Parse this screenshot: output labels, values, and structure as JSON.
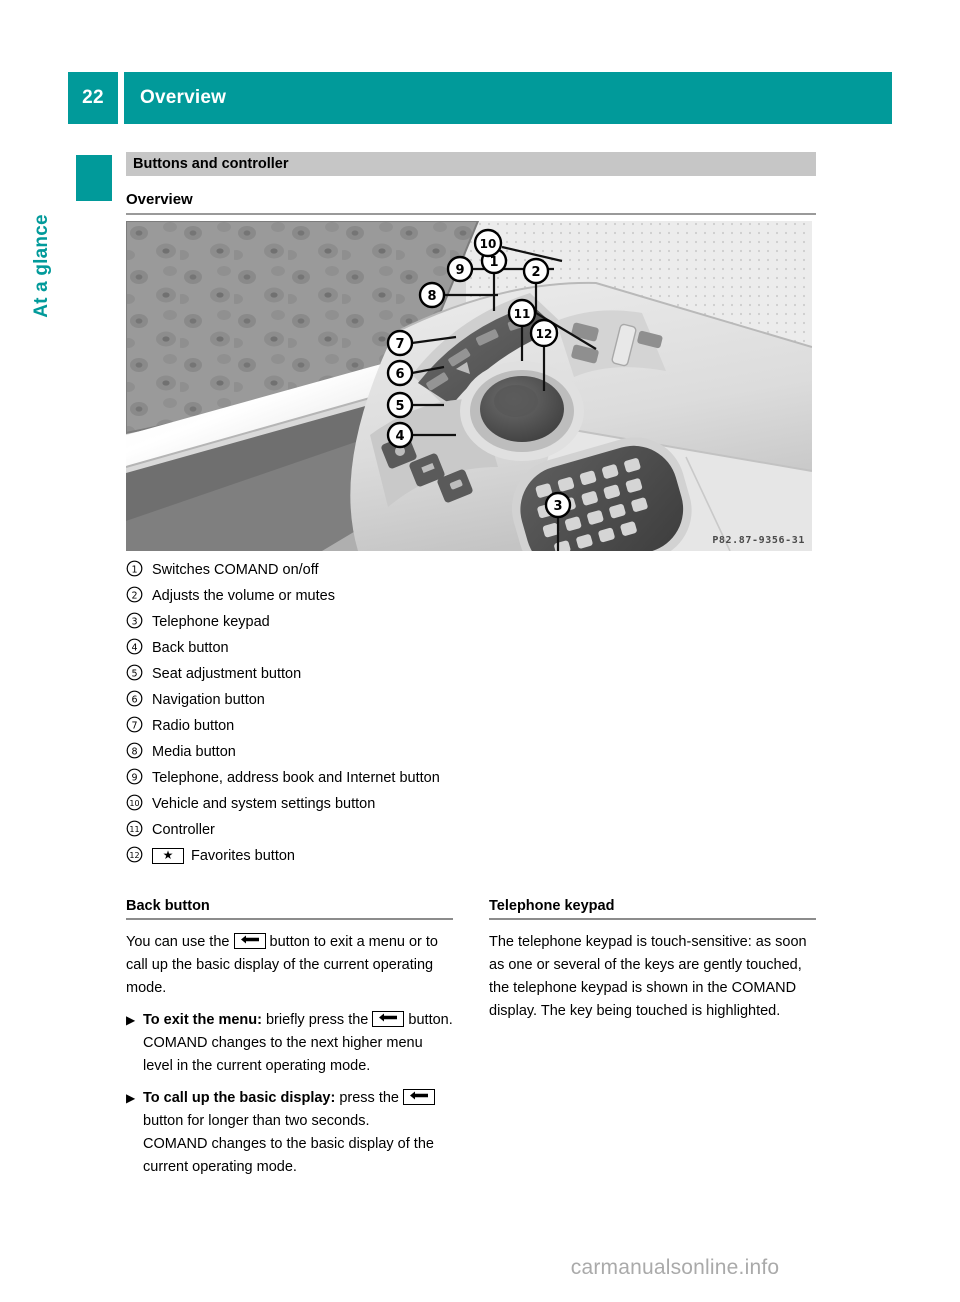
{
  "header": {
    "page_number": "22",
    "title": "Overview"
  },
  "side_tab": {
    "label": "At a glance"
  },
  "section": {
    "bar_title": "Buttons and controller",
    "sub_heading": "Overview"
  },
  "figure": {
    "image_code": "P82.87-9356-31",
    "alt": "COMAND center console with buttons, controller and telephone keypad",
    "callouts": [
      "1",
      "2",
      "3",
      "4",
      "5",
      "6",
      "7",
      "8",
      "9",
      "10",
      "11",
      "12"
    ]
  },
  "legend": {
    "items": [
      {
        "marker": "1",
        "label": "Switches COMAND on/off"
      },
      {
        "marker": "2",
        "label": "Adjusts the volume or mutes"
      },
      {
        "marker": "3",
        "label": "Telephone keypad"
      },
      {
        "marker": "4",
        "label": "Back button"
      },
      {
        "marker": "5",
        "label": "Seat adjustment button"
      },
      {
        "marker": "6",
        "label": "Navigation button"
      },
      {
        "marker": "7",
        "label": "Radio button"
      },
      {
        "marker": "8",
        "label": "Media button"
      },
      {
        "marker": "9",
        "label": "Telephone, address book and Internet button"
      },
      {
        "marker": "10",
        "label": "Vehicle and system settings button"
      },
      {
        "marker": "11",
        "label": "Controller"
      },
      {
        "marker": "12",
        "label": "Favorites button",
        "key_icon": "star-key-icon"
      }
    ]
  },
  "columns": {
    "left": {
      "heading": "Back button",
      "intro_before_key": "You can use the",
      "intro_after_key": "button to exit a menu or to call up the basic display of the current operating mode.",
      "steps": [
        {
          "bullet": "▶",
          "bold": "To exit the menu:",
          "text_before_key": " briefly press the",
          "text_after_key": "button.",
          "follow_up": "COMAND changes to the next higher menu level in the current operating mode."
        },
        {
          "bullet": "▶",
          "bold": "To call up the basic display:",
          "text_before_key": " press the",
          "text_after_key": "button for longer than two seconds.",
          "follow_up": "COMAND changes to the basic display of the current operating mode."
        }
      ]
    },
    "right": {
      "heading": "Telephone keypad",
      "body": "The telephone keypad is touch-sensitive: as soon as one or several of the keys are gently touched, the telephone keypad is shown in the COMAND display. The key being touched is highlighted."
    }
  },
  "watermark": {
    "text": "carmanualsonline.info"
  },
  "colors": {
    "teal": "#019A9A",
    "section_bar_gray": "#C6C6C6",
    "rule_gray": "#8C8C8C"
  }
}
